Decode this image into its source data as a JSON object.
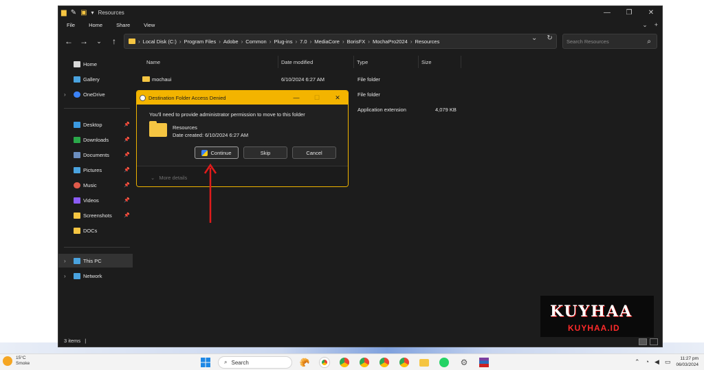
{
  "window": {
    "title": "Resources",
    "minimize": "—",
    "maximize": "❐",
    "close": "✕"
  },
  "ribbon": {
    "file": "File",
    "home": "Home",
    "share": "Share",
    "view": "View"
  },
  "address": {
    "segments": [
      "Local Disk (C:)",
      "Program Files",
      "Adobe",
      "Common",
      "Plug-ins",
      "7.0",
      "MediaCore",
      "BorisFX",
      "MochaPro2024",
      "Resources"
    ],
    "search_placeholder": "Search Resources"
  },
  "sidebar": {
    "items": [
      {
        "label": "Home",
        "icon": "home-icon",
        "color": "#e0e0e0"
      },
      {
        "label": "Gallery",
        "icon": "gallery-icon",
        "color": "#4aa3df"
      },
      {
        "label": "OneDrive",
        "icon": "cloud-icon",
        "color": "#3b82f6"
      },
      {
        "label": "Desktop",
        "icon": "desktop-icon",
        "color": "#3b9ae1"
      },
      {
        "label": "Downloads",
        "icon": "download-icon",
        "color": "#2aa84a"
      },
      {
        "label": "Documents",
        "icon": "documents-icon",
        "color": "#6c8ebf"
      },
      {
        "label": "Pictures",
        "icon": "pictures-icon",
        "color": "#4aa3df"
      },
      {
        "label": "Music",
        "icon": "music-icon",
        "color": "#e05a4a"
      },
      {
        "label": "Videos",
        "icon": "videos-icon",
        "color": "#8b5cf6"
      },
      {
        "label": "Screenshots",
        "icon": "folder-icon",
        "color": "#f5c542"
      },
      {
        "label": "DOCs",
        "icon": "folder-icon",
        "color": "#f5c542"
      },
      {
        "label": "This PC",
        "icon": "pc-icon",
        "color": "#4aa3df"
      },
      {
        "label": "Network",
        "icon": "network-icon",
        "color": "#4aa3df"
      }
    ]
  },
  "columns": {
    "name": "Name",
    "date": "Date modified",
    "type": "Type",
    "size": "Size"
  },
  "files": [
    {
      "name": "mochaui",
      "date": "6/10/2024 6:27 AM",
      "type": "File folder",
      "size": ""
    },
    {
      "name": "",
      "date": "",
      "type": "File folder",
      "size": ""
    },
    {
      "name": "",
      "date": "",
      "type": "Application extension",
      "size": "4,079 KB"
    }
  ],
  "status": {
    "count": "3 items"
  },
  "dialog": {
    "title": "Destination Folder Access Denied",
    "message": "You'll need to provide administrator permission to move to this folder",
    "folder_name": "Resources",
    "folder_date": "Date created: 6/10/2024 6:27 AM",
    "continue": "Continue",
    "skip": "Skip",
    "cancel": "Cancel",
    "more_details": "More details",
    "accent": "#f3b400"
  },
  "watermark": {
    "logo": "KUYHAA",
    "site": "KUYHAA.ID"
  },
  "taskbar": {
    "temp": "15°C",
    "weather": "Smoke",
    "search": "Search",
    "time": "11:27 pm",
    "date": "06/03/2024"
  }
}
